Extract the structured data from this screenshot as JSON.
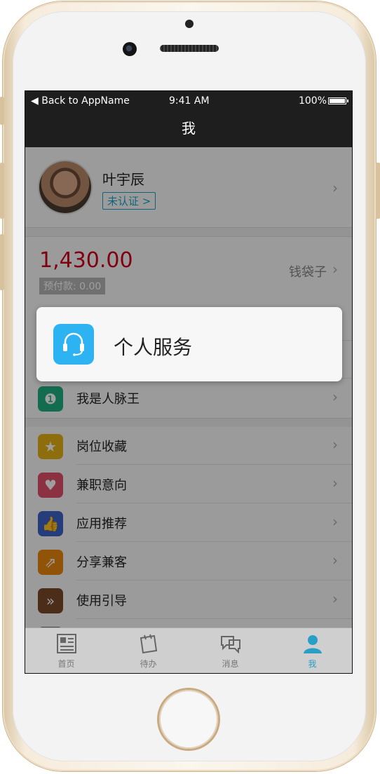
{
  "status_bar": {
    "back": "Back to AppName",
    "time": "9:41 AM",
    "battery": "100%"
  },
  "nav": {
    "title": "我"
  },
  "profile": {
    "name": "叶宇辰",
    "verify_badge": "未认证 >"
  },
  "wallet": {
    "amount": "1,430.00",
    "prepay": "预付款: 0.00",
    "label": "钱袋子"
  },
  "menu_top": [
    {
      "label": "我是人脉王",
      "icon": "award-icon",
      "color": "#1fae82"
    }
  ],
  "menu": [
    {
      "label": "岗位收藏",
      "icon": "star-icon",
      "color": "#e6b114"
    },
    {
      "label": "兼职意向",
      "icon": "heart-icon",
      "color": "#e0506a"
    },
    {
      "label": "应用推荐",
      "icon": "thumbs-up-icon",
      "color": "#3c63c5"
    },
    {
      "label": "分享兼客",
      "icon": "share-icon",
      "color": "#e8870e"
    },
    {
      "label": "使用引导",
      "icon": "double-chevron-icon",
      "color": "#7a4a2a"
    }
  ],
  "popup": {
    "label": "个人服务",
    "icon": "headset-icon",
    "color": "#2db3f2"
  },
  "tabs": [
    {
      "label": "首页",
      "icon": "news-icon"
    },
    {
      "label": "待办",
      "icon": "notes-icon"
    },
    {
      "label": "消息",
      "icon": "chat-icon"
    },
    {
      "label": "我",
      "icon": "user-icon",
      "active": true
    }
  ]
}
